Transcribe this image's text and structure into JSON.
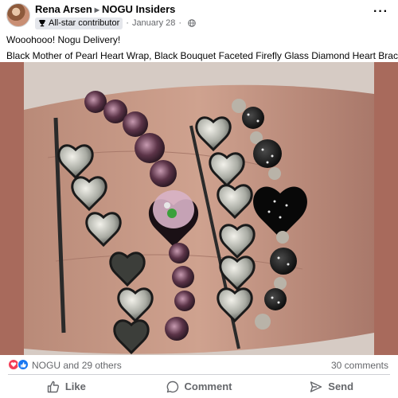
{
  "post": {
    "author": "Rena Arsen",
    "group": "NOGU Insiders",
    "badge": "All-star contributor",
    "date": "January 28",
    "caption_line1": "Wooohooo! Nogu Delivery!",
    "caption_line2": "Black Mother of Pearl Heart Wrap, Black Bouquet Faceted Firefly Glass Diamond Heart Bracelet,"
  },
  "reactions": {
    "summary": "NOGU and 29 others",
    "comments": "30 comments",
    "colors": {
      "love": "#f33e58",
      "like": "#1877f2"
    }
  },
  "actions": {
    "like_label": "Like",
    "comment_label": "Comment",
    "send_label": "Send"
  },
  "icons": [
    "trophy-icon",
    "globe-icon",
    "more-icon",
    "love-reaction-icon",
    "like-reaction-icon",
    "like-icon",
    "comment-icon",
    "send-icon"
  ]
}
